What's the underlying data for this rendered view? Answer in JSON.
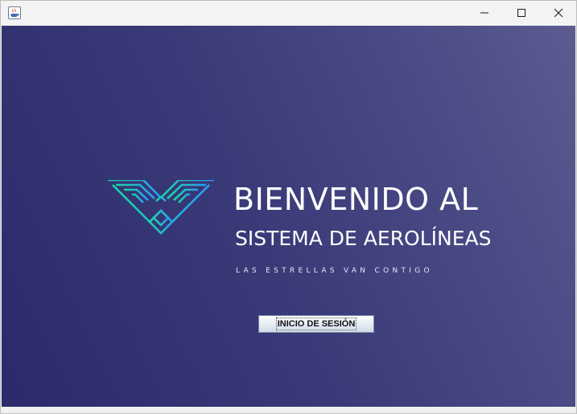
{
  "window": {
    "app_icon": "java-icon",
    "controls": {
      "minimize_icon": "minimize-icon",
      "maximize_icon": "maximize-icon",
      "close_icon": "close-icon"
    }
  },
  "welcome": {
    "logo_icon": "eagle-wings-icon",
    "title_line1": "BIENVENIDO AL",
    "title_line2": "SISTEMA DE AEROLÍNEAS",
    "tagline": "LAS ESTRELLAS VAN CONTIGO"
  },
  "login": {
    "button_label": "INICIO DE SESIÓN"
  },
  "colors": {
    "background_start": "#2b2b6c",
    "background_end": "#5c5c91",
    "logo_green": "#19d6a0",
    "logo_blue": "#2a9df4",
    "text": "#ffffff"
  }
}
